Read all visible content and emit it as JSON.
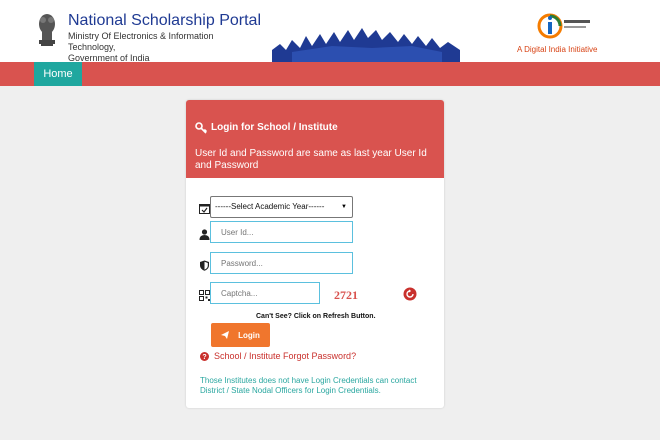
{
  "header": {
    "portal_title": "National Scholarship Portal",
    "ministry_line1": "Ministry Of Electronics & Information Technology,",
    "ministry_line2": "Government of India",
    "digital_india_tagline": "A Digital India Initiative",
    "emblem_icon": "national-emblem-icon",
    "digital_india_logo": "digital-india-logo"
  },
  "nav": {
    "home_label": "Home"
  },
  "login": {
    "title": "Login for School / Institute",
    "note": "User Id and Password are same as last year User Id and Password",
    "academic_year_selected": "------Select Academic Year------",
    "user_id_placeholder": "User Id...",
    "password_placeholder": "Password...",
    "captcha_placeholder": "Captcha...",
    "captcha_text": "2721",
    "cant_see": "Can't See? Click on Refresh Button.",
    "login_button": "Login",
    "forgot_password": "School / Institute Forgot Password?",
    "contact_note": "Those Institutes does not have Login Credentials can contact District / State Nodal Officers for Login Credentials."
  },
  "icons": {
    "key": "key-icon",
    "calendar": "calendar-icon",
    "user": "user-icon",
    "shield": "shield-icon",
    "qr": "qr-icon",
    "refresh": "refresh-icon",
    "send": "paper-plane-icon",
    "question": "question-circle-icon"
  },
  "colors": {
    "nav_red": "#d9534f",
    "home_teal": "#1fa79f",
    "login_orange": "#f0762d",
    "input_border": "#5bc0de",
    "title_blue": "#1f3a93"
  }
}
